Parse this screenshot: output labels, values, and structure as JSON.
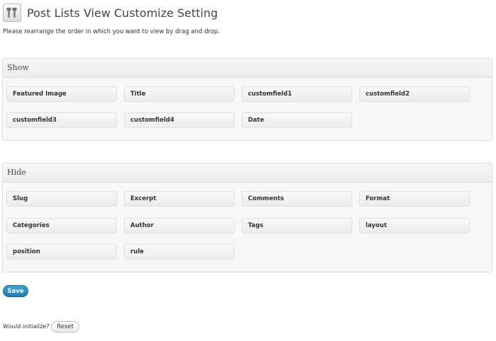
{
  "header": {
    "title": "Post Lists View Customize Setting",
    "icon": "tools-icon"
  },
  "description": "Please rearrange the order in which you want to view by drag and drop.",
  "show_panel": {
    "title": "Show",
    "items": [
      "Featured Image",
      "Title",
      "customfield1",
      "customfield2",
      "customfield3",
      "customfield4",
      "Date"
    ]
  },
  "hide_panel": {
    "title": "Hide",
    "items": [
      "Slug",
      "Excerpt",
      "Comments",
      "Format",
      "Categories",
      "Author",
      "Tags",
      "layout",
      "position",
      "rule"
    ]
  },
  "save_button": "Save",
  "initialize": {
    "label": "Would initialize?",
    "reset_button": "Reset"
  },
  "colors": {
    "primary_button": "#2382bd",
    "panel_background": "#f8f8f8",
    "panel_border": "#dcdcdc"
  }
}
